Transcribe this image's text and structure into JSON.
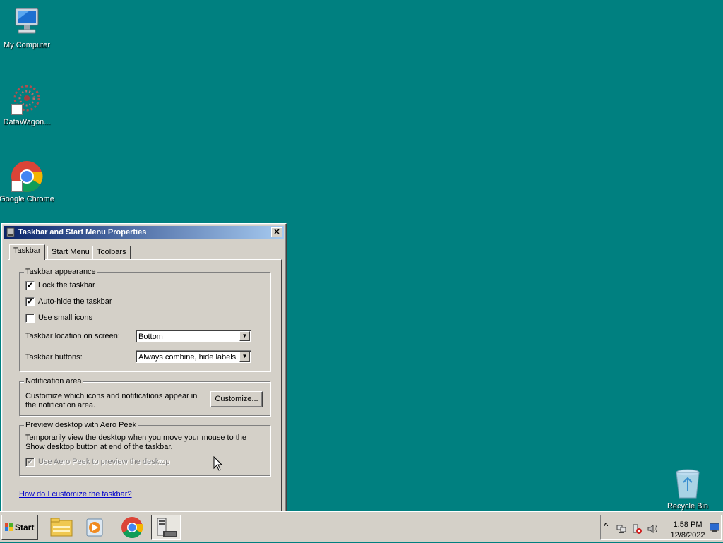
{
  "desktop": {
    "icons": [
      {
        "label": "My Computer",
        "icon": "computer-icon"
      },
      {
        "label": "DataWagon...",
        "icon": "datawagon-icon"
      },
      {
        "label": "Google Chrome",
        "icon": "chrome-icon"
      },
      {
        "label": "Recycle Bin",
        "icon": "recycle-bin-icon"
      }
    ],
    "background": "#008080"
  },
  "dialog": {
    "title": "Taskbar and Start Menu Properties",
    "close": "✕",
    "tabs": [
      "Taskbar",
      "Start Menu",
      "Toolbars"
    ],
    "active_tab": "Taskbar",
    "appearance": {
      "legend": "Taskbar appearance",
      "lock": {
        "label": "Lock the taskbar",
        "checked": true
      },
      "autohide": {
        "label": "Auto-hide the taskbar",
        "checked": true
      },
      "small_icons": {
        "label": "Use small icons",
        "checked": false
      },
      "location_label": "Taskbar location on screen:",
      "location_value": "Bottom",
      "buttons_label": "Taskbar buttons:",
      "buttons_value": "Always combine, hide labels"
    },
    "notification": {
      "legend": "Notification area",
      "text": "Customize which icons and notifications appear in the notification area.",
      "customize": "Customize..."
    },
    "aero": {
      "legend": "Preview desktop with Aero Peek",
      "text": "Temporarily view the desktop when you move your mouse to the Show desktop button at end of the taskbar.",
      "checkbox": {
        "label": "Use Aero Peek to preview the desktop",
        "checked": true,
        "disabled": true
      }
    },
    "help_link": "How do I customize the taskbar?"
  },
  "taskbar": {
    "start": "Start",
    "pinned": [
      "file-explorer-icon",
      "media-player-icon",
      "chrome-icon",
      "server-manager-icon"
    ],
    "tray": {
      "chevron": "^",
      "time": "1:58 PM",
      "date": "12/8/2022"
    }
  },
  "check_glyph": "✔",
  "dropdown_glyph": "▼"
}
